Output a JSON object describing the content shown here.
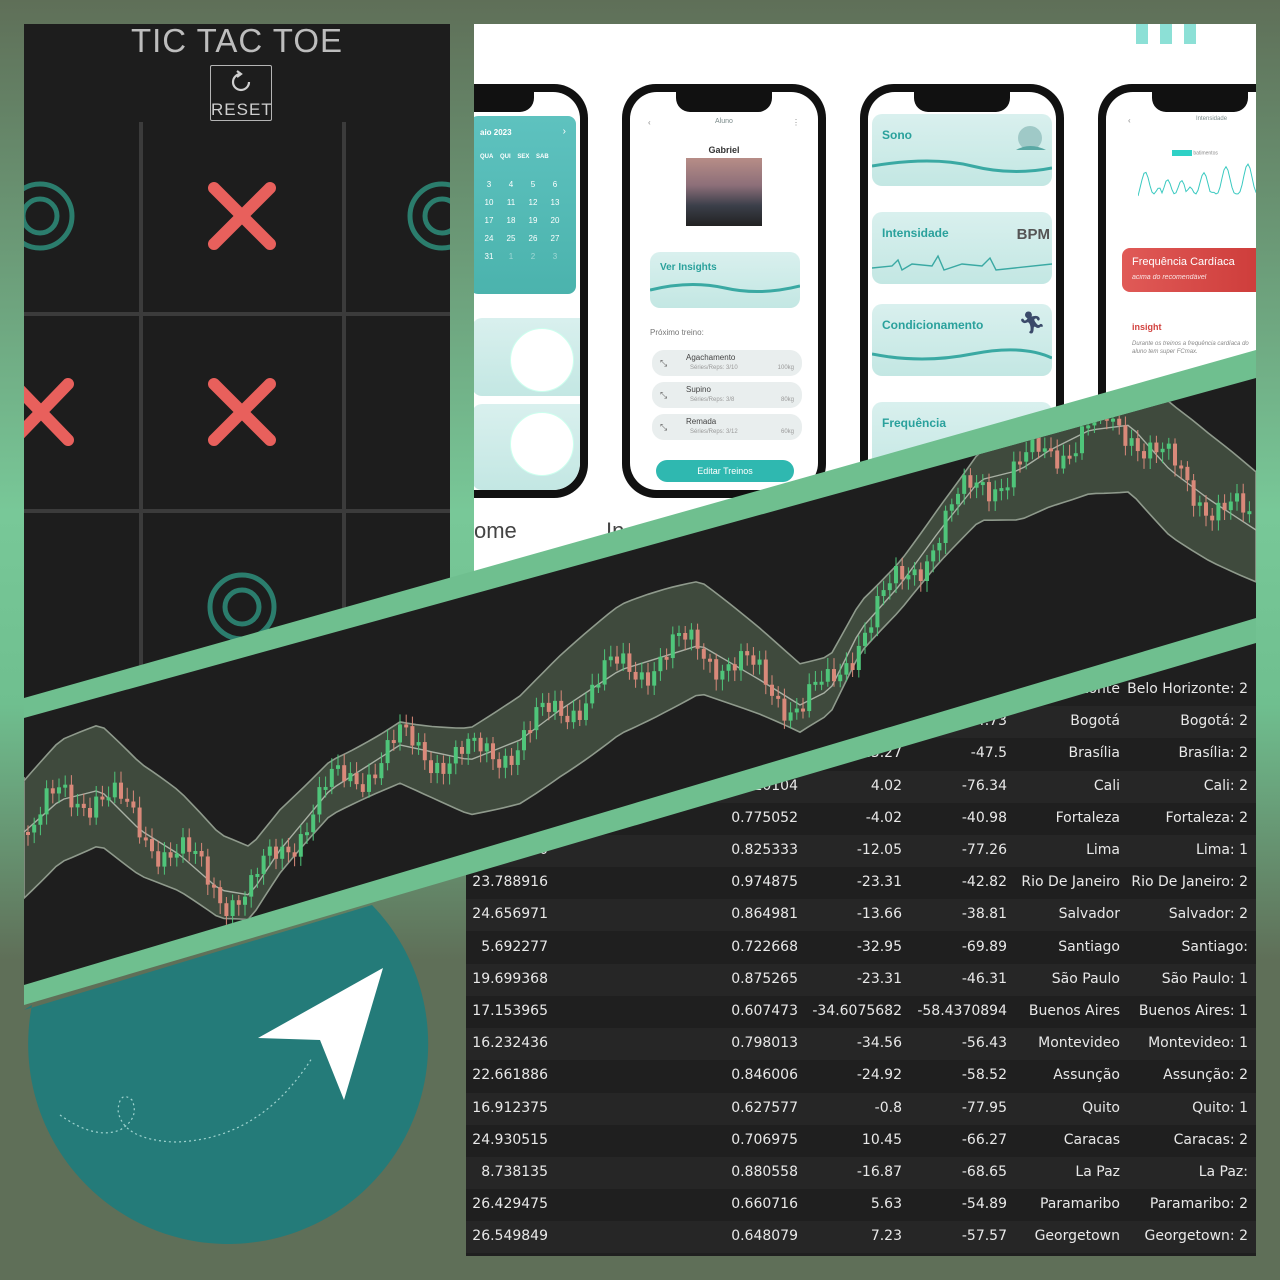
{
  "colors": {
    "frame_green": "#6fbf8f",
    "chart_bg": "#1f1f1f",
    "bull": "#4fc57a",
    "bear": "#d9897a",
    "teal": "#2aa19c",
    "ttt_x": "#e8605c",
    "ttt_o": "#2b7d6d",
    "nav_teal": "#247b79"
  },
  "tictactoe": {
    "title": "TIC TAC TOE",
    "reset_label": "RESET",
    "reset_icon": "refresh-icon",
    "cells": [
      "O",
      "X",
      "O",
      "X",
      "X",
      "",
      "",
      "O",
      ""
    ]
  },
  "fitness": {
    "calendar": {
      "month": "aio 2023",
      "weekdays": [
        "QUA",
        "QUI",
        "SEX",
        "SAB"
      ],
      "days": [
        "3",
        "4",
        "5",
        "6",
        "10",
        "11",
        "12",
        "13",
        "17",
        "18",
        "19",
        "20",
        "24",
        "25",
        "26",
        "27",
        "31",
        "1",
        "2",
        "3"
      ]
    },
    "profile": {
      "header": "Aluno",
      "name": "Gabriel",
      "insights_label": "Ver Insights",
      "next_label": "Próximo treino:",
      "exercises": [
        {
          "name": "Agachamento",
          "sets": "Séries/Reps: 3/10",
          "weight": "100kg"
        },
        {
          "name": "Supino",
          "sets": "Séries/Reps: 3/8",
          "weight": "80kg"
        },
        {
          "name": "Remada",
          "sets": "Séries/Reps: 3/12",
          "weight": "60kg"
        }
      ],
      "edit_button": "Editar Treinos"
    },
    "metrics": [
      "Sono",
      "Intensidade",
      "BPM",
      "Condicionamento",
      "Frequência"
    ],
    "detail": {
      "header": "Intensidade",
      "legend": "batimentos",
      "alert_title": "Frequência Cardíaca",
      "alert_sub": "acima do recomendável",
      "insight_title": "insight",
      "insight_text": "Durante os treinos a frequência cardíaca do aluno tem super FCmax."
    },
    "tabs": [
      "ome",
      "In"
    ]
  },
  "table": {
    "rows": [
      {
        "c1": "",
        "c2": "",
        "c3": "",
        "c4": "",
        "c5": "orizonte",
        "c6": "Belo Horizonte: 2"
      },
      {
        "c1": "",
        "c2": "",
        "c3": "",
        "c4": "-74.73",
        "c5": "Bogotá",
        "c6": "Bogotá: 2"
      },
      {
        "c1": "",
        "c2": "",
        "c3": "-15.27",
        "c4": "-47.5",
        "c5": "Brasília",
        "c6": "Brasília: 2"
      },
      {
        "c1": "",
        "c2": "3.710104",
        "c3": "4.02",
        "c4": "-76.34",
        "c5": "Cali",
        "c6": "Cali: 2"
      },
      {
        "c1": "",
        "c2": "0.775052",
        "c3": "-4.02",
        "c4": "-40.98",
        "c5": "Fortaleza",
        "c6": "Fortaleza: 2"
      },
      {
        "c1": "120",
        "c2": "0.825333",
        "c3": "-12.05",
        "c4": "-77.26",
        "c5": "Lima",
        "c6": "Lima: 1"
      },
      {
        "c1": "23.788916",
        "c2": "0.974875",
        "c3": "-23.31",
        "c4": "-42.82",
        "c5": "Rio De Janeiro",
        "c6": "Rio De Janeiro: 2"
      },
      {
        "c1": "24.656971",
        "c2": "0.864981",
        "c3": "-13.66",
        "c4": "-38.81",
        "c5": "Salvador",
        "c6": "Salvador: 2"
      },
      {
        "c1": "5.692277",
        "c2": "0.722668",
        "c3": "-32.95",
        "c4": "-69.89",
        "c5": "Santiago",
        "c6": "Santiago:"
      },
      {
        "c1": "19.699368",
        "c2": "0.875265",
        "c3": "-23.31",
        "c4": "-46.31",
        "c5": "São Paulo",
        "c6": "São Paulo: 1"
      },
      {
        "c1": "17.153965",
        "c2": "0.607473",
        "c3": "-34.6075682",
        "c4": "-58.4370894",
        "c5": "Buenos Aires",
        "c6": "Buenos Aires: 1"
      },
      {
        "c1": "16.232436",
        "c2": "0.798013",
        "c3": "-34.56",
        "c4": "-56.43",
        "c5": "Montevideo",
        "c6": "Montevideo: 1"
      },
      {
        "c1": "22.661886",
        "c2": "0.846006",
        "c3": "-24.92",
        "c4": "-58.52",
        "c5": "Assunção",
        "c6": "Assunção: 2"
      },
      {
        "c1": "16.912375",
        "c2": "0.627577",
        "c3": "-0.8",
        "c4": "-77.95",
        "c5": "Quito",
        "c6": "Quito: 1"
      },
      {
        "c1": "24.930515",
        "c2": "0.706975",
        "c3": "10.45",
        "c4": "-66.27",
        "c5": "Caracas",
        "c6": "Caracas: 2"
      },
      {
        "c1": "8.738135",
        "c2": "0.880558",
        "c3": "-16.87",
        "c4": "-68.65",
        "c5": "La Paz",
        "c6": "La Paz:"
      },
      {
        "c1": "26.429475",
        "c2": "0.660716",
        "c3": "5.63",
        "c4": "-54.89",
        "c5": "Paramaribo",
        "c6": "Paramaribo: 2"
      },
      {
        "c1": "26.549849",
        "c2": "0.648079",
        "c3": "7.23",
        "c4": "-57.57",
        "c5": "Georgetown",
        "c6": "Georgetown: 2"
      }
    ]
  },
  "nav": {
    "icon": "navigation-arrow-icon"
  }
}
